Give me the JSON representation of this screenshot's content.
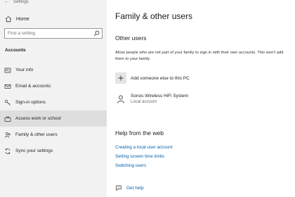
{
  "window": {
    "title": "Settings"
  },
  "sidebar": {
    "home_label": "Home",
    "search_placeholder": "Find a setting",
    "section_header": "Accounts",
    "items": [
      {
        "label": "Your info",
        "icon": "user-card-icon",
        "selected": false
      },
      {
        "label": "Email & accounts",
        "icon": "mail-icon",
        "selected": false
      },
      {
        "label": "Sign-in options",
        "icon": "key-icon",
        "selected": false
      },
      {
        "label": "Access work or school",
        "icon": "briefcase-icon",
        "selected": true
      },
      {
        "label": "Family & other users",
        "icon": "people-icon",
        "selected": false
      },
      {
        "label": "Sync your settings",
        "icon": "sync-icon",
        "selected": false
      }
    ]
  },
  "main": {
    "title": "Family & other users",
    "other_users": {
      "heading": "Other users",
      "description": "Allow people who are not part of your family to sign in with their own accounts. This won't add them to your family.",
      "add_label": "Add someone else to this PC",
      "accounts": [
        {
          "name": "Sonos Wireless HiFi System",
          "type": "Local account"
        }
      ]
    },
    "help": {
      "heading": "Help from the web",
      "links": [
        "Creating a local user account",
        "Setting screen time limits",
        "Switching users"
      ]
    },
    "get_help_label": "Get help"
  },
  "colors": {
    "link": "#0063b1",
    "sidebar_bg": "#f2f2f2",
    "selected_bg": "#dedede"
  }
}
